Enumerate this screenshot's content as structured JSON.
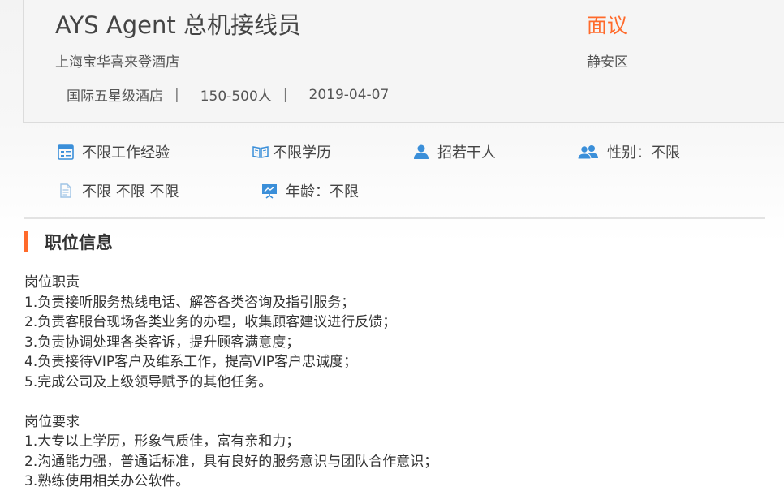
{
  "job": {
    "title": "AYS Agent 总机接线员",
    "salary": "面议",
    "company": "上海宝华喜来登酒店",
    "district": "静安区",
    "meta": [
      "国际五星级酒店",
      "150-500人",
      "2019-04-07"
    ],
    "separator": "|"
  },
  "requirements": {
    "experience": "不限工作经验",
    "education": "不限学历",
    "headcount": "招若干人",
    "gender": "性别：不限",
    "misc": "不限 不限 不限",
    "age": "年龄：不限"
  },
  "section": {
    "title": "职位信息"
  },
  "description": {
    "duties_heading": "岗位职责",
    "duties": [
      "1.负责接听服务热线电话、解答各类咨询及指引服务；",
      "2.负责客服台现场各类业务的办理，收集顾客建议进行反馈；",
      "3.负责协调处理各类客诉，提升顾客满意度；",
      "4.负责接待VIP客户及维系工作，提高VIP客户忠诚度；",
      "5.完成公司及上级领导赋予的其他任务。"
    ],
    "reqs_heading": "岗位要求",
    "reqs": [
      "1.大专以上学历，形象气质佳，富有亲和力；",
      "2.沟通能力强，普通话标准，具有良好的服务意识与团队合作意识；",
      "3.熟练使用相关办公软件。"
    ]
  },
  "colors": {
    "accent": "#ff6a2b",
    "icon_blue": "#3b8fd9"
  }
}
